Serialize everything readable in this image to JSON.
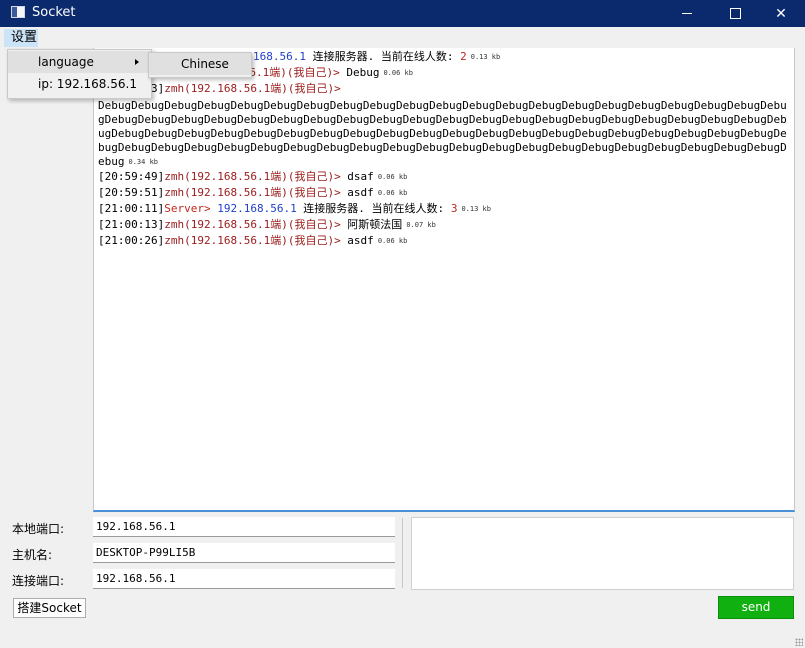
{
  "window": {
    "title": "Socket"
  },
  "menu": {
    "settings": "设置",
    "dropdown": [
      {
        "label": "language",
        "has_submenu": true
      },
      {
        "label": "ip: 192.168.56.1"
      }
    ],
    "language_submenu": [
      {
        "label": "Chinese"
      }
    ]
  },
  "log": {
    "lines": [
      {
        "visible_text": "168.56.1",
        "rest": " 连接服务器. 当前在线人数: ",
        "count": "2",
        "size": "0.13 kb"
      },
      {
        "time": "8]",
        "user": "zmh(192.168.56.1端)(我自己)>",
        "msg": " Debug",
        "size": "0.06 kb"
      },
      {
        "time": "[20:59:23]",
        "user": "zmh(192.168.56.1端)(我自己)>"
      },
      {
        "long_msg": "DebugDebugDebugDebugDebugDebugDebugDebugDebugDebugDebugDebugDebugDebugDebugDebugDebugDebugDebugDebugDebugDebugDebugDebugDebugDebugDebugDebugDebugDebugDebugDebugDebugDebugDebugDebugDebugDebugDebugDebugDebugDebugDebugDebugDebugDebugDebugDebugDebugDebugDebugDebugDebugDebugDebugDebugDebugDebugDebugDebugDebugDebugDebugDebugDebugDebugDebugDebugDebugDebugDebugDebugDebugDebugDebugDebugDebugDebugDebugDebugDebugDebugDebugDebug",
        "size": "0.34 kb"
      },
      {
        "time": "[20:59:49]",
        "user": "zmh(192.168.56.1端)(我自己)>",
        "msg": " dsaf",
        "size": "0.06 kb"
      },
      {
        "time": "[20:59:51]",
        "user": "zmh(192.168.56.1端)(我自己)>",
        "msg": " asdf",
        "size": "0.06 kb"
      },
      {
        "time": "[21:00:11]",
        "server": "Server>",
        "ip": " 192.168.56.1",
        "rest": " 连接服务器. 当前在线人数: ",
        "count": "3",
        "size": "0.13 kb"
      },
      {
        "time": "[21:00:13]",
        "user": "zmh(192.168.56.1端)(我自己)>",
        "msg": " 阿斯顿法国",
        "size": "0.07 kb"
      },
      {
        "time": "[21:00:26]",
        "user": "zmh(192.168.56.1端)(我自己)>",
        "msg": " asdf",
        "size": "0.06 kb"
      }
    ]
  },
  "form": {
    "local_port_label": "本地端口:",
    "local_port_value": "192.168.56.1",
    "host_label": "主机名:",
    "host_value": "DESKTOP-P99LI5B",
    "connect_port_label": "连接端口:",
    "connect_port_value": "192.168.56.1"
  },
  "buttons": {
    "build": "搭建Socket",
    "send": "send"
  },
  "colors": {
    "titlebar": "#0b2a6e",
    "send_button": "#0fb00f",
    "user": "#9a1a1a",
    "server": "#c0281f",
    "ip": "#1f3ec8"
  }
}
